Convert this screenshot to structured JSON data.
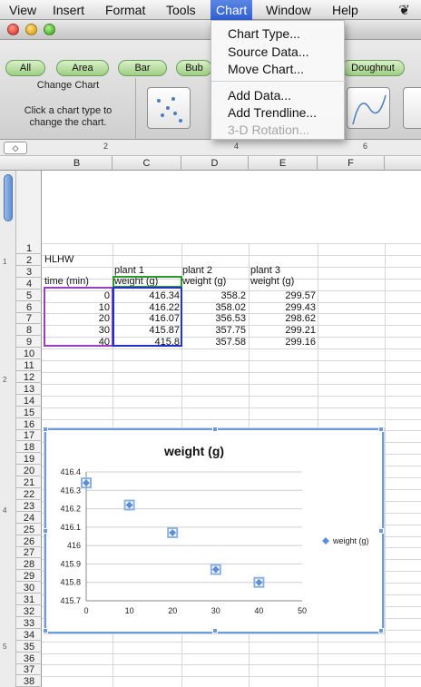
{
  "menubar": {
    "items": [
      "View",
      "Insert",
      "Format",
      "Tools",
      "Chart",
      "Window",
      "Help"
    ],
    "active": "Chart"
  },
  "chart_menu": {
    "items": [
      {
        "label": "Chart Type...",
        "disabled": false
      },
      {
        "label": "Source Data...",
        "disabled": false
      },
      {
        "label": "Move Chart...",
        "disabled": false
      },
      {
        "label": "Add Data...",
        "disabled": false
      },
      {
        "label": "Add Trendline...",
        "disabled": false
      },
      {
        "label": "3-D Rotation...",
        "disabled": true
      }
    ]
  },
  "ribbon": {
    "tabs": [
      "All",
      "Area",
      "Bar",
      "Bub",
      "Doughnut"
    ],
    "group_title": "Change Chart",
    "group_desc": "Click a chart type to change the chart."
  },
  "columns": [
    "B",
    "C",
    "D",
    "E",
    "F"
  ],
  "rows": [
    "1",
    "2",
    "3",
    "4",
    "5",
    "6",
    "7",
    "8",
    "9",
    "10",
    "11",
    "12",
    "13",
    "14",
    "15",
    "16",
    "17",
    "18",
    "19",
    "20",
    "21",
    "22",
    "23",
    "24",
    "25",
    "26",
    "27",
    "28",
    "29",
    "30",
    "31",
    "32",
    "33",
    "34",
    "35",
    "36",
    "37",
    "38"
  ],
  "sheet": {
    "b2": "HLHW",
    "c3": "plant 1",
    "d3": "plant 2",
    "e3": "plant 3",
    "b4": "time (min)",
    "c4": "weight (g)",
    "d4": "weight (g)",
    "e4": "weight (g)",
    "data": [
      [
        "0",
        "416.34",
        "358.2",
        "299.57"
      ],
      [
        "10",
        "416.22",
        "358.02",
        "299.43"
      ],
      [
        "20",
        "416.07",
        "356.53",
        "298.62"
      ],
      [
        "30",
        "415.87",
        "357.75",
        "299.21"
      ],
      [
        "40",
        "415.8",
        "357.58",
        "299.16"
      ]
    ]
  },
  "colors": {
    "series": "#5b8fd6",
    "selection_b": "#9b3fc0",
    "selection_c": "#2233cc",
    "header_green": "#2a9a2a"
  },
  "chart_data": {
    "type": "scatter",
    "title": "weight (g)",
    "x": [
      0,
      10,
      20,
      30,
      40
    ],
    "series": [
      {
        "name": "weight (g)",
        "values": [
          416.34,
          416.22,
          416.07,
          415.87,
          415.8
        ]
      }
    ],
    "xlim": [
      0,
      50
    ],
    "ylim": [
      415.7,
      416.4
    ],
    "xticks": [
      "0",
      "10",
      "20",
      "30",
      "40",
      "50"
    ],
    "yticks": [
      "416.4",
      "416.3",
      "416.2",
      "416.1",
      "416",
      "415.9",
      "415.8",
      "415.7"
    ],
    "legend": "right",
    "grid": true
  }
}
